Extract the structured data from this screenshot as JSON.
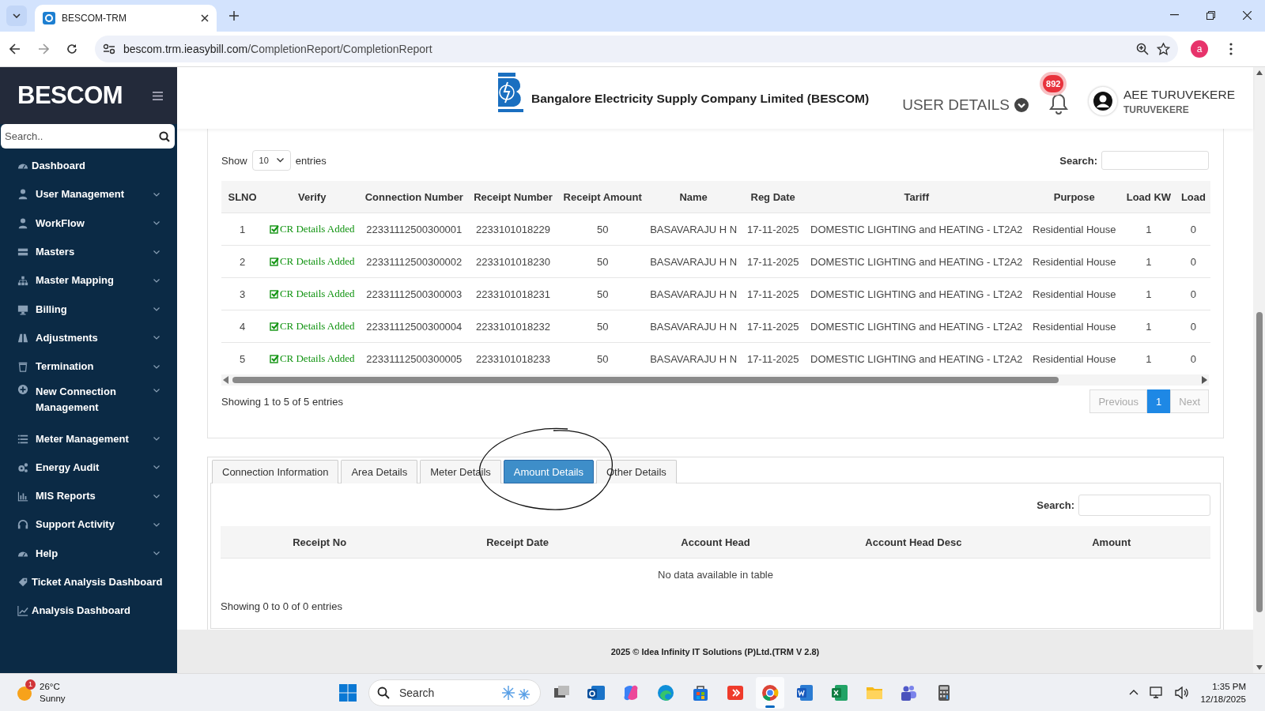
{
  "browser": {
    "tab_title": "BESCOM-TRM",
    "url_host": "bescom.trm.ieasybill.com",
    "url_path": "/CompletionReport/CompletionReport",
    "profile_initial": "a"
  },
  "sidebar": {
    "brand": "BESCOM",
    "search_placeholder": "Search..",
    "items": [
      {
        "label": "Dashboard",
        "expandable": false
      },
      {
        "label": "User Management",
        "expandable": true
      },
      {
        "label": "WorkFlow",
        "expandable": true
      },
      {
        "label": "Masters",
        "expandable": true
      },
      {
        "label": "Master Mapping",
        "expandable": true
      },
      {
        "label": "Billing",
        "expandable": true
      },
      {
        "label": "Adjustments",
        "expandable": true
      },
      {
        "label": "Termination",
        "expandable": true
      },
      {
        "label": "New Connection Management",
        "expandable": true
      },
      {
        "label": "Meter Management",
        "expandable": true
      },
      {
        "label": "Energy Audit",
        "expandable": true
      },
      {
        "label": "MIS Reports",
        "expandable": true
      },
      {
        "label": "Support Activity",
        "expandable": true
      },
      {
        "label": "Help",
        "expandable": true
      },
      {
        "label": "Ticket Analysis Dashboard",
        "expandable": false
      },
      {
        "label": "Analysis Dashboard",
        "expandable": false
      }
    ]
  },
  "header": {
    "company": "Bangalore Electricity Supply Company Limited (BESCOM)",
    "user_details": "USER DETAILS",
    "notifications": "892",
    "user_name": "AEE TURUVEKERE",
    "user_location": "TURUVEKERE"
  },
  "report": {
    "show_label": "Show",
    "page_size": "10",
    "entries_label": "entries",
    "search_label": "Search:",
    "columns": [
      {
        "label": "SLNO",
        "kind": "text"
      },
      {
        "label": "Verify",
        "kind": "verify"
      },
      {
        "label": "Connection Number",
        "kind": "text"
      },
      {
        "label": "Receipt Number",
        "kind": "text"
      },
      {
        "label": "Receipt Amount",
        "kind": "text"
      },
      {
        "label": "Name",
        "kind": "text"
      },
      {
        "label": "Reg Date",
        "kind": "text"
      },
      {
        "label": "Tariff",
        "kind": "text"
      },
      {
        "label": "Purpose",
        "kind": "text"
      },
      {
        "label": "Load KW",
        "kind": "text"
      },
      {
        "label": "Load",
        "kind": "text"
      }
    ],
    "rows": [
      {
        "cells": [
          "1",
          "CR Details Added",
          "22331112500300001",
          "2233101018229",
          "50",
          "BASAVARAJU H N",
          "17-11-2025",
          "DOMESTIC LIGHTING and HEATING - LT2A2",
          "Residential House",
          "1",
          "0"
        ]
      },
      {
        "cells": [
          "2",
          "CR Details Added",
          "22331112500300002",
          "2233101018230",
          "50",
          "BASAVARAJU H N",
          "17-11-2025",
          "DOMESTIC LIGHTING and HEATING - LT2A2",
          "Residential House",
          "1",
          "0"
        ]
      },
      {
        "cells": [
          "3",
          "CR Details Added",
          "22331112500300003",
          "2233101018231",
          "50",
          "BASAVARAJU H N",
          "17-11-2025",
          "DOMESTIC LIGHTING and HEATING - LT2A2",
          "Residential House",
          "1",
          "0"
        ]
      },
      {
        "cells": [
          "4",
          "CR Details Added",
          "22331112500300004",
          "2233101018232",
          "50",
          "BASAVARAJU H N",
          "17-11-2025",
          "DOMESTIC LIGHTING and HEATING - LT2A2",
          "Residential House",
          "1",
          "0"
        ]
      },
      {
        "cells": [
          "5",
          "CR Details Added",
          "22331112500300005",
          "2233101018233",
          "50",
          "BASAVARAJU H N",
          "17-11-2025",
          "DOMESTIC LIGHTING and HEATING - LT2A2",
          "Residential House",
          "1",
          "0"
        ]
      }
    ],
    "summary": "Showing 1 to 5 of 5 entries",
    "pagination": [
      {
        "label": "Previous",
        "selected": false,
        "disabled": true
      },
      {
        "label": "1",
        "selected": true,
        "disabled": false
      },
      {
        "label": "Next",
        "selected": false,
        "disabled": true
      }
    ]
  },
  "details": {
    "tabs": [
      {
        "label": "Connection Information",
        "selected": false
      },
      {
        "label": "Area Details",
        "selected": false
      },
      {
        "label": "Meter Details",
        "selected": false
      },
      {
        "label": "Amount Details",
        "selected": true
      },
      {
        "label": "Other Details",
        "selected": false
      }
    ],
    "search_label": "Search:",
    "columns": [
      "Receipt No",
      "Receipt Date",
      "Account Head",
      "Account Head Desc",
      "Amount"
    ],
    "empty_message": "No data available in table",
    "summary": "Showing 0 to 0 of 0 entries"
  },
  "footer": "2025 © Idea Infinity IT Solutions (P)Ltd.(TRM V 2.8)",
  "taskbar": {
    "weather_badge": "1",
    "temperature": "26°C",
    "condition": "Sunny",
    "search_placeholder": "Search",
    "time": "1:35 PM",
    "date": "12/18/2025"
  }
}
